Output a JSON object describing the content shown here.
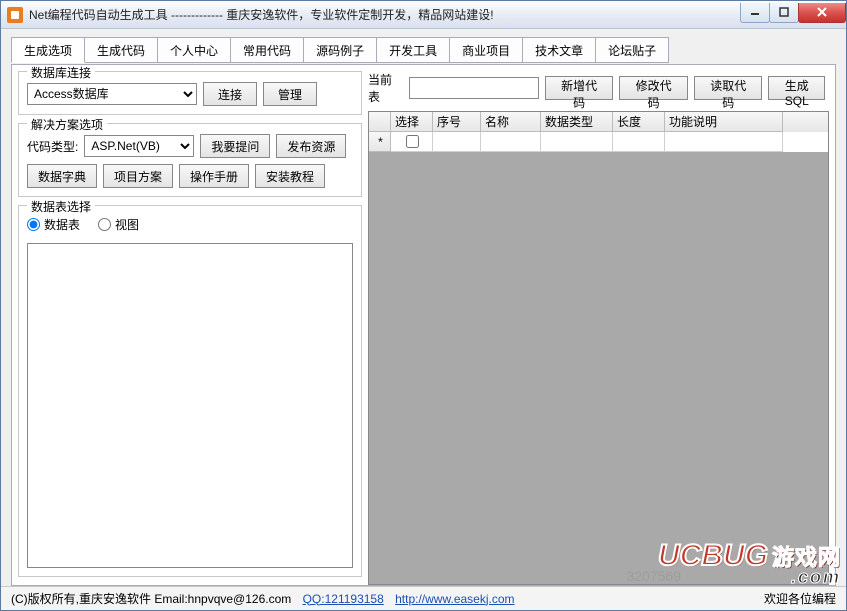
{
  "window": {
    "title": "Net编程代码自动生成工具 ------------- 重庆安逸软件，专业软件定制开发，精品网站建设!"
  },
  "tabs": [
    "生成选项",
    "生成代码",
    "个人中心",
    "常用代码",
    "源码例子",
    "开发工具",
    "商业项目",
    "技术文章",
    "论坛贴子"
  ],
  "groups": {
    "db": {
      "legend": "数据库连接",
      "combo": "Access数据库",
      "connect": "连接",
      "manage": "管理"
    },
    "solution": {
      "legend": "解决方案选项",
      "label_codetype": "代码类型:",
      "combo": "ASP.Net(VB)",
      "ask": "我要提问",
      "publish": "发布资源",
      "dict": "数据字典",
      "proj": "项目方案",
      "manual": "操作手册",
      "install": "安装教程"
    },
    "tablesel": {
      "legend": "数据表选择",
      "radio_table": "数据表",
      "radio_view": "视图"
    }
  },
  "right": {
    "label_current": "当前表",
    "btn_new": "新增代码",
    "btn_edit": "修改代码",
    "btn_read": "读取代码",
    "btn_sql": "生成SQL"
  },
  "grid": {
    "cols": {
      "sel": "选择",
      "seq": "序号",
      "name": "名称",
      "type": "数据类型",
      "len": "长度",
      "desc": "功能说明"
    },
    "newrow_marker": "*"
  },
  "footer": {
    "copyright": "(C)版权所有,重庆安逸软件 Email:hnpvqve@126.com",
    "qq": "QQ:121193158",
    "url": "http://www.easekj.com",
    "welcome": "欢迎各位编程"
  },
  "watermark": {
    "brand": "UCBUG",
    "brand_cn": "游戏网",
    "dotcom": ".com",
    "faded": "3207569"
  }
}
